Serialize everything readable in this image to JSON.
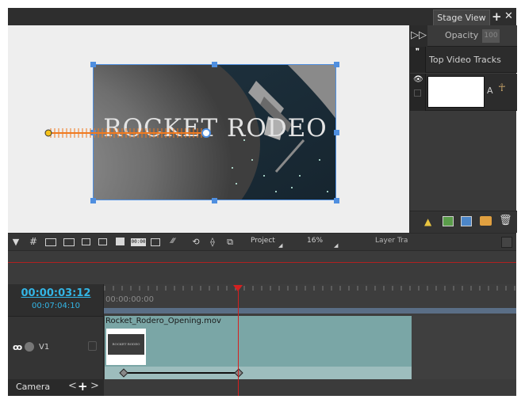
{
  "stage_panel": {
    "tab_label": "Stage View",
    "add_icon": "plus-icon",
    "close_icon": "close-icon"
  },
  "stage": {
    "video_title": "ROCKET RODEO"
  },
  "right_panel": {
    "opacity_label": "Opacity",
    "opacity_value": "100",
    "track_name": "Top Video Tracks",
    "track_letter": "A"
  },
  "toolbar": {
    "timecode_badge": "00:00",
    "project_label": "Project",
    "zoom_value": "16%",
    "layer_label": "Layer Tra"
  },
  "timeline": {
    "current_time": "00:00:03:12",
    "total_time": "00:07:04:10",
    "ruler_start": "00:00:00:00",
    "clip_name": "Rocket_Rodero_Opening.mov",
    "track_label": "V1",
    "thumbnail_text": "ROCKET RODEO",
    "camera_label": "Camera",
    "playhead_color": "#d42020",
    "clip_color": "#7aa6a6",
    "timecode_color": "#33b5e5"
  }
}
